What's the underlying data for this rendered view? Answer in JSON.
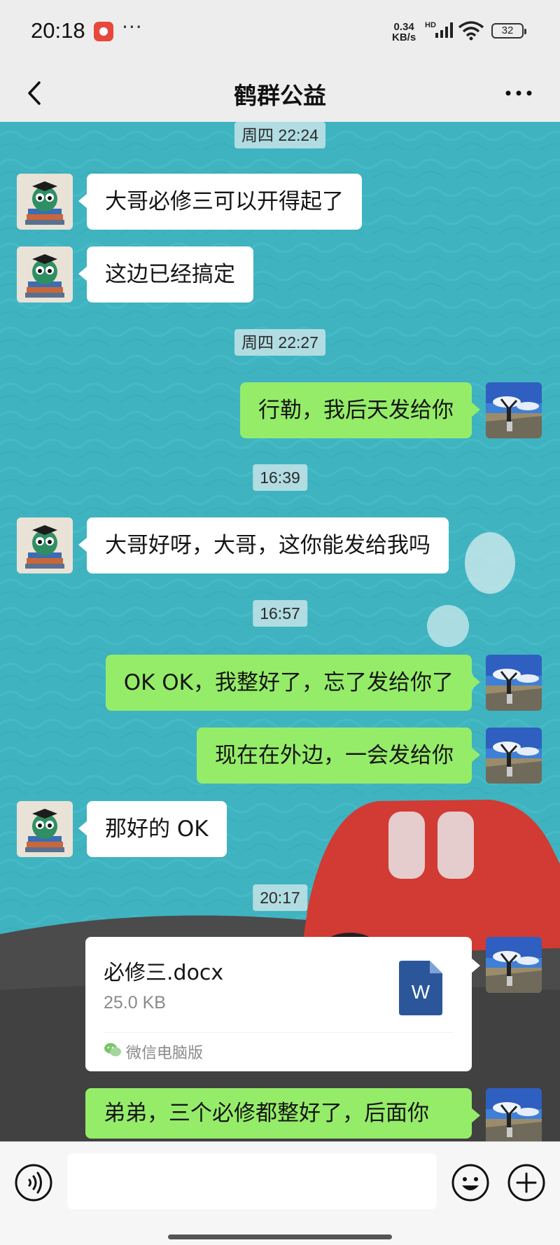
{
  "status_bar": {
    "time": "20:18",
    "more": "···",
    "net_speed_value": "0.34",
    "net_speed_unit": "KB/s",
    "hd_label": "HD",
    "battery": "32"
  },
  "header": {
    "title": "鹤群公益"
  },
  "chat": {
    "timestamps": [
      "周四 22:24",
      "周四 22:27",
      "16:39",
      "16:57",
      "20:17"
    ],
    "messages": [
      {
        "sender": "contact",
        "text": "大哥必修三可以开得起了"
      },
      {
        "sender": "contact",
        "text": "这边已经搞定"
      },
      {
        "sender": "me",
        "text": "行勒，我后天发给你"
      },
      {
        "sender": "contact",
        "text": "大哥好呀，大哥，这你能发给我吗"
      },
      {
        "sender": "me",
        "text": "OK OK，我整好了，忘了发给你了"
      },
      {
        "sender": "me",
        "text": "现在在外边，一会发给你"
      },
      {
        "sender": "contact",
        "text": "那好的 OK"
      },
      {
        "sender": "me",
        "text": "弟弟，三个必修都整好了，后面你"
      }
    ],
    "file": {
      "name": "必修三.docx",
      "size": "25.0 KB",
      "icon_letter": "W",
      "source": "微信电脑版",
      "icon": "word-doc-icon"
    }
  },
  "input_bar": {
    "placeholder": "",
    "icons": [
      "voice-icon",
      "emoji-icon",
      "plus-icon"
    ]
  },
  "colors": {
    "chat_background": "#3fb3c0",
    "sent_bubble": "#95ec69",
    "received_bubble": "#ffffff",
    "word_blue": "#2b579a"
  }
}
